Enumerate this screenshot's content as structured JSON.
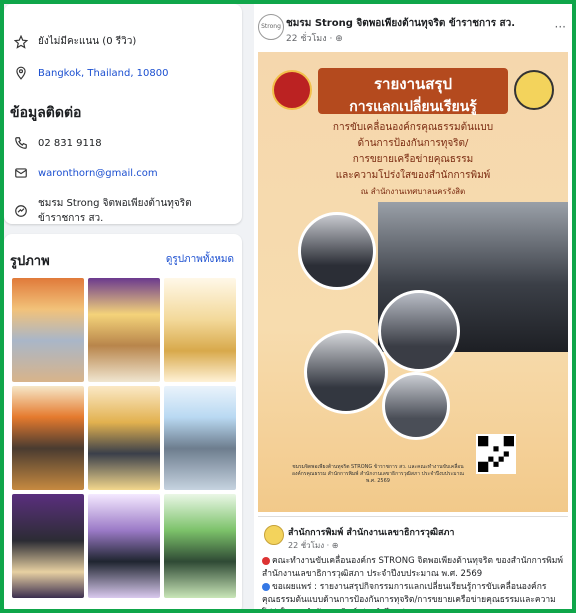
{
  "intro": {
    "rating": "ยังไม่มีคะแนน (0 รีวิว)",
    "location": "Bangkok, Thailand, 10800"
  },
  "contact": {
    "title": "ข้อมูลติดต่อ",
    "phone": "02 831 9118",
    "email": "waronthorn@gmail.com",
    "messenger": "ชมรม Strong จิตพอเพียงต้านทุจริต ข้าราชการ สว."
  },
  "photos": {
    "title": "รูปภาพ",
    "see_all": "ดูรูปภาพทั้งหมด"
  },
  "post": {
    "page_name": "ชมรม Strong จิตพอเพียงต้านทุจริต ข้าราชการ สว.",
    "time": "22 ชั่วโมง · ",
    "more": "···",
    "avatar_text": "Strong",
    "poster": {
      "title1": "รายงานสรุป",
      "title2": "การแลกเปลี่ยนเรียนรู้",
      "line1": "การขับเคลื่อนองค์กรคุณธรรมต้นแบบ",
      "line2": "ด้านการป้องกันการทุจริต/",
      "line3": "การขยายเครือข่ายคุณธรรม",
      "line4": "และความโปร่งใสของสำนักการพิมพ์",
      "line5": "ณ สำนักงานเทศบาลนครรังสิต",
      "footer": "ชมรมจิตพอเพียงต้านทุจริต STRONG ข้าราชการ สว. และคณะทำงานขับเคลื่อนองค์กรคุณธรรม สำนักการพิมพ์ สำนักงานเลขาธิการวุฒิสภา ประจำปีงบประมาณ พ.ศ. 2569"
    }
  },
  "shared": {
    "name": "สำนักการพิมพ์ สำนักงานเลขาธิการวุฒิสภา",
    "time": "22 ชั่วโมง · ",
    "text1": "คณะทำงานขับเคลื่อนองค์กร STRONG จิตพอเพียงต้านทุจริต ของสำนักการพิมพ์ สำนักงานเลขาธิการวุฒิสภา ประจำปีงบประมาณ พ.ศ. 2569",
    "text2": "ขอเผยแพร่ : รายงานสรุปกิจกรรมการแลกเปลี่ยนเรียนรู้การขับเคลื่อนองค์กรคุณธรรมต้นแบบด้านการป้องกันการทุจริต/การขยายเครือข่ายคุณธรรมและความโปร่งใสของสำนักการพิมพ์ ประจำปีงบประมาณ"
  },
  "colors": {
    "frame": "#0fa64a",
    "link": "#1b4fd0",
    "poster_banner": "#b44a1e"
  }
}
